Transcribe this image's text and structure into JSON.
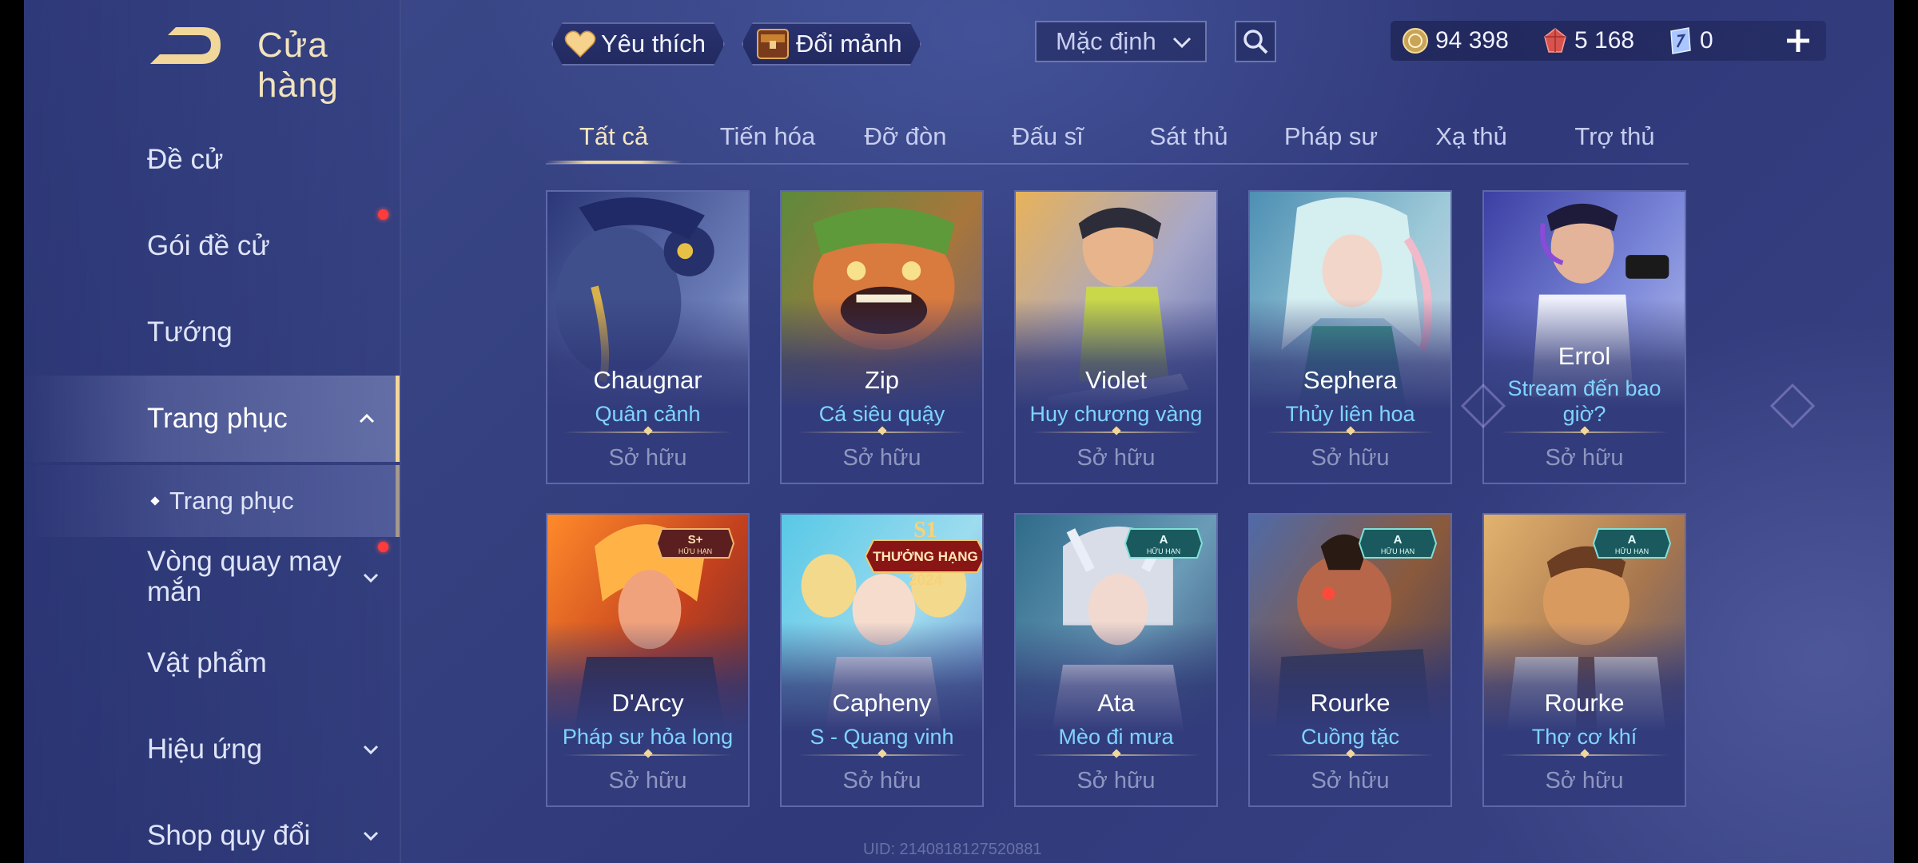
{
  "header": {
    "title": "Cửa hàng",
    "favorite_label": "Yêu thích",
    "exchange_label": "Đổi mảnh",
    "sort_value": "Mặc định"
  },
  "currency": {
    "gold": "94 398",
    "ruby": "5 168",
    "voucher": "0"
  },
  "sidebar": {
    "items": [
      {
        "label": "Đề cử"
      },
      {
        "label": "Gói đề cử"
      },
      {
        "label": "Tướng"
      },
      {
        "label": "Trang phục"
      },
      {
        "label": "Trang phục"
      },
      {
        "label": "Vòng quay may mắn"
      },
      {
        "label": "Vật phẩm"
      },
      {
        "label": "Hiệu ứng"
      },
      {
        "label": "Shop quy đổi"
      }
    ]
  },
  "tabs": [
    "Tất cả",
    "Tiến hóa",
    "Đỡ đòn",
    "Đấu sĩ",
    "Sát thủ",
    "Pháp sư",
    "Xạ thủ",
    "Trợ thủ"
  ],
  "cards": [
    {
      "hero": "Chaugnar",
      "skin": "Quân cảnh",
      "status": "Sở hữu"
    },
    {
      "hero": "Zip",
      "skin": "Cá siêu quậy",
      "status": "Sở hữu"
    },
    {
      "hero": "Violet",
      "skin": "Huy chương vàng",
      "status": "Sở hữu"
    },
    {
      "hero": "Sephera",
      "skin": "Thủy liên hoa",
      "status": "Sở hữu"
    },
    {
      "hero": "Errol",
      "skin": "Stream đến bao giờ?",
      "status": "Sở hữu"
    },
    {
      "hero": "D'Arcy",
      "skin": "Pháp sư hỏa long",
      "status": "Sở hữu",
      "badge": "S+",
      "badge_sub": "HỮU HẠN"
    },
    {
      "hero": "Capheny",
      "skin": "S - Quang vinh",
      "status": "Sở hữu",
      "ranked_top": "S1",
      "ranked_mid": "THƯỞNG HẠNG",
      "ranked_bot": "2024"
    },
    {
      "hero": "Ata",
      "skin": "Mèo đi mưa",
      "status": "Sở hữu",
      "badge": "A",
      "badge_sub": "HỮU HẠN"
    },
    {
      "hero": "Rourke",
      "skin": "Cuồng tặc",
      "status": "Sở hữu",
      "badge": "A",
      "badge_sub": "HỮU HẠN"
    },
    {
      "hero": "Rourke",
      "skin": "Thợ cơ khí",
      "status": "Sở hữu",
      "badge": "A",
      "badge_sub": "HỮU HẠN"
    }
  ],
  "footer": {
    "uid": "UID: 2140818127520881"
  },
  "colors": {
    "accent_gold": "#f2d79a",
    "skin_blue": "#7fd4ff",
    "notify_red": "#ff3b3b"
  }
}
